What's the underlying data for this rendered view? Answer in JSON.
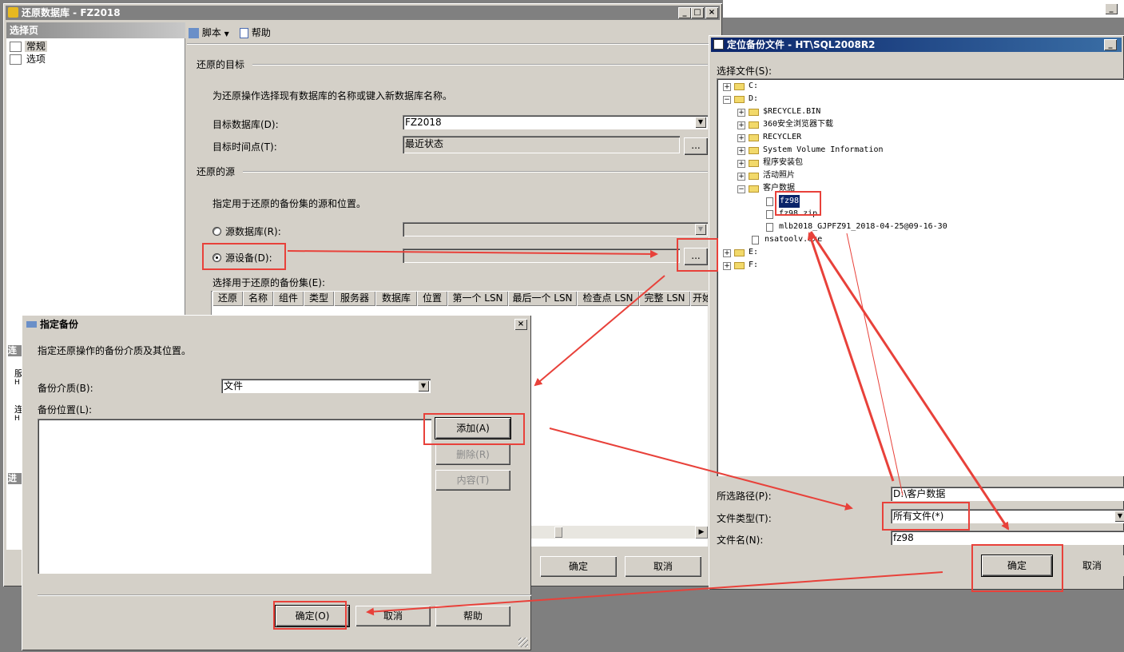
{
  "restore_window": {
    "title": "还原数据库 - FZ2018",
    "select_page_header": "选择页",
    "pages": [
      "常规",
      "选项"
    ],
    "toolbar": {
      "script": "脚本",
      "help": "帮助"
    },
    "dest_group": "还原的目标",
    "dest_desc": "为还原操作选择现有数据库的名称或键入新数据库名称。",
    "target_db_label": "目标数据库(D):",
    "target_db_value": "FZ2018",
    "target_time_label": "目标时间点(T):",
    "target_time_value": "最近状态",
    "source_group": "还原的源",
    "source_desc": "指定用于还原的备份集的源和位置。",
    "source_db_label": "源数据库(R):",
    "source_device_label": "源设备(D):",
    "backup_sets_label": "选择用于还原的备份集(E):",
    "grid_columns": [
      "还原",
      "名称",
      "组件",
      "类型",
      "服务器",
      "数据库",
      "位置",
      "第一个 LSN",
      "最后一个 LSN",
      "检查点 LSN",
      "完整 LSN",
      "开始"
    ],
    "browse_label": "...",
    "left_partial": [
      "连",
      "服",
      "H",
      "连",
      "H",
      "进"
    ],
    "ok": "确定",
    "cancel": "取消"
  },
  "specify_dialog": {
    "title": "指定备份",
    "desc": "指定还原操作的备份介质及其位置。",
    "media_label": "备份介质(B):",
    "media_value": "文件",
    "location_label": "备份位置(L):",
    "add": "添加(A)",
    "remove": "删除(R)",
    "contents": "内容(T)",
    "ok": "确定(O)",
    "cancel": "取消",
    "help": "帮助"
  },
  "locate_dialog": {
    "title": "定位备份文件 - HT\\SQL2008R2",
    "select_file_label": "选择文件(S):",
    "tree": [
      {
        "label": "C:",
        "level": 0,
        "kind": "folder",
        "expander": "+"
      },
      {
        "label": "D:",
        "level": 0,
        "kind": "folder",
        "expander": "-"
      },
      {
        "label": "$RECYCLE.BIN",
        "level": 1,
        "kind": "folder",
        "expander": "+"
      },
      {
        "label": "360安全浏览器下载",
        "level": 1,
        "kind": "folder",
        "expander": "+"
      },
      {
        "label": "RECYCLER",
        "level": 1,
        "kind": "folder",
        "expander": "+"
      },
      {
        "label": "System Volume Information",
        "level": 1,
        "kind": "folder",
        "expander": "+"
      },
      {
        "label": "程序安装包",
        "level": 1,
        "kind": "folder",
        "expander": "+"
      },
      {
        "label": "活动照片",
        "level": 1,
        "kind": "folder",
        "expander": "+"
      },
      {
        "label": "客户数据",
        "level": 1,
        "kind": "folder",
        "expander": "-"
      },
      {
        "label": "fz98",
        "level": 2,
        "kind": "file",
        "expander": "",
        "selected": true
      },
      {
        "label": "fz98.zip",
        "level": 2,
        "kind": "file",
        "expander": ""
      },
      {
        "label": "mlb2018_GJPFZ91_2018-04-25@09-16-30",
        "level": 2,
        "kind": "file",
        "expander": ""
      },
      {
        "label": "nsatoolv.exe",
        "level": 1,
        "kind": "file",
        "expander": ""
      },
      {
        "label": "E:",
        "level": 0,
        "kind": "folder",
        "expander": "+"
      },
      {
        "label": "F:",
        "level": 0,
        "kind": "folder",
        "expander": "+"
      }
    ],
    "path_label": "所选路径(P):",
    "path_value": "D:\\客户数据",
    "type_label": "文件类型(T):",
    "type_value": "所有文件(*)",
    "name_label": "文件名(N):",
    "name_value": "fz98",
    "ok": "确定",
    "cancel": "取消"
  },
  "colors": {
    "annotation": "#e8413a",
    "title_active": "#0a246a",
    "title_inactive": "#808080",
    "face": "#d4d0c8"
  }
}
